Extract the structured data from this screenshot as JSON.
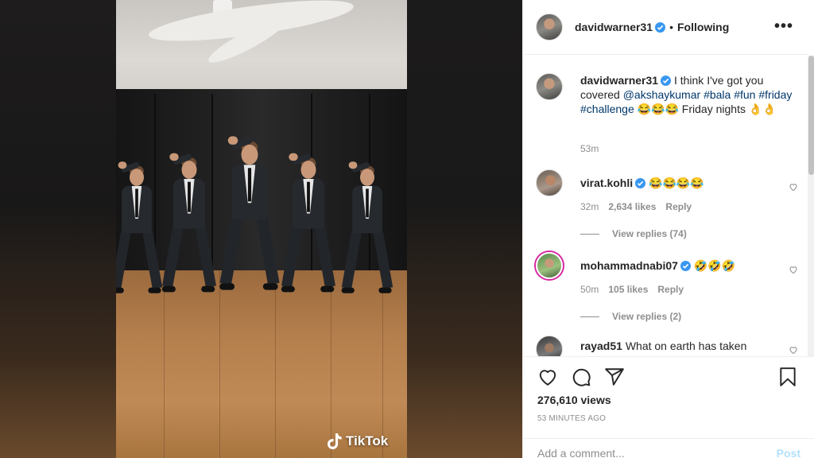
{
  "video": {
    "watermark": "TikTok",
    "watermark_icon": "tiktok-note-icon"
  },
  "header": {
    "username": "davidwarner31",
    "separator": "•",
    "follow_label": "Following",
    "more_label": "•••"
  },
  "caption": {
    "username": "davidwarner31",
    "text_before": "I think I've got you covered ",
    "tags": [
      "@akshaykumar",
      "#bala",
      "#fun",
      "#friday",
      "#challenge"
    ],
    "text_after": "😂😂😂 Friday nights 👌👌",
    "time": "53m"
  },
  "comments": [
    {
      "username": "virat.kohli",
      "verified": true,
      "text": "😂😂😂😂",
      "time": "32m",
      "likes": "2,634 likes",
      "reply_label": "Reply",
      "view_replies": "View replies (74)"
    },
    {
      "username": "mohammadnabi07",
      "verified": true,
      "text": "🤣🤣🤣",
      "time": "50m",
      "likes": "105 likes",
      "reply_label": "Reply",
      "view_replies": "View replies (2)"
    },
    {
      "username": "rayad51",
      "verified": false,
      "text": "What on earth has taken"
    }
  ],
  "actions": {
    "like_icon": "heart-icon",
    "comment_icon": "comment-icon",
    "share_icon": "share-icon",
    "save_icon": "bookmark-icon",
    "views": "276,610 views",
    "posted": "53 MINUTES AGO"
  },
  "add_comment": {
    "placeholder": "Add a comment...",
    "post_label": "Post"
  },
  "colors": {
    "verified": "#3897f0",
    "link": "#00376b",
    "muted": "#8e8e8e",
    "post_disabled": "#b2dffc"
  }
}
